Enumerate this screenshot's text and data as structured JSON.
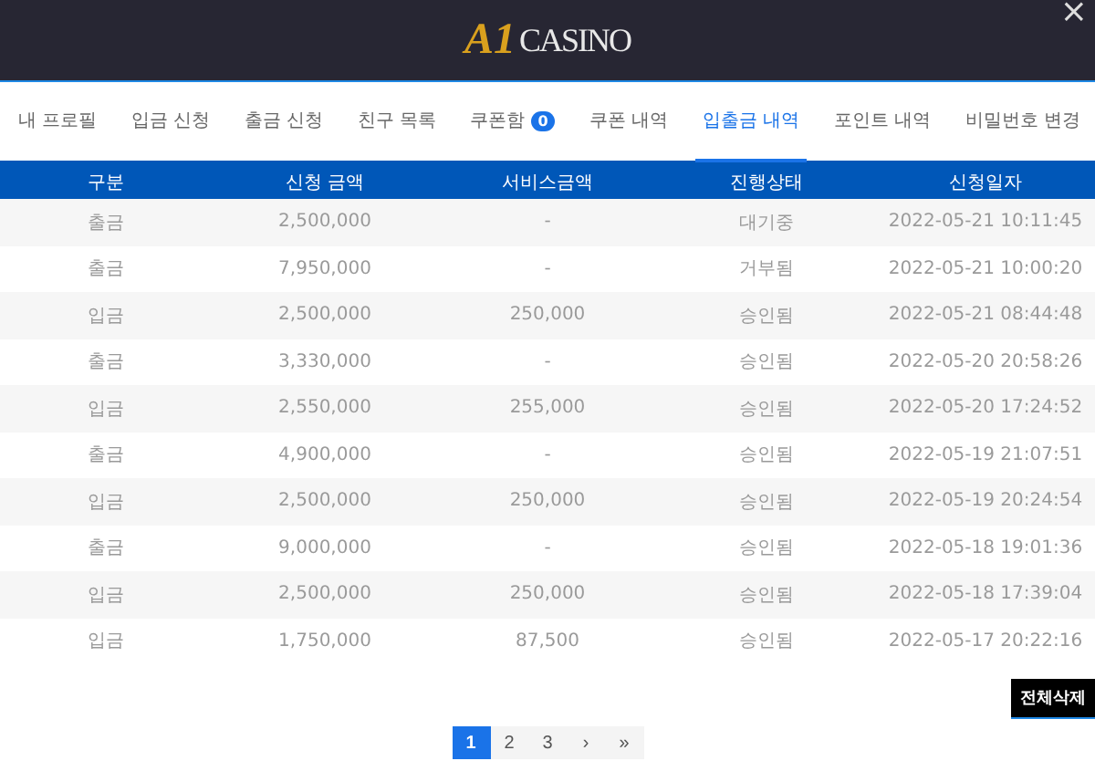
{
  "header": {
    "logo": {
      "mark": "A1",
      "text": "CASINO"
    },
    "close": "×"
  },
  "tabs": [
    {
      "label": "내 프로필",
      "selected": false
    },
    {
      "label": "입금 신청",
      "selected": false
    },
    {
      "label": "출금 신청",
      "selected": false
    },
    {
      "label": "친구 목록",
      "selected": false
    },
    {
      "label": "쿠폰함",
      "badge": "0",
      "selected": false
    },
    {
      "label": "쿠폰 내역",
      "selected": false
    },
    {
      "label": "입출금 내역",
      "selected": true
    },
    {
      "label": "포인트 내역",
      "selected": false
    },
    {
      "label": "비밀번호 변경",
      "selected": false
    }
  ],
  "table": {
    "columns": [
      "구분",
      "신청 금액",
      "서비스금액",
      "진행상태",
      "신청일자"
    ],
    "rows": [
      [
        "출금",
        "2,500,000",
        "-",
        "대기중",
        "2022-05-21 10:11:45"
      ],
      [
        "출금",
        "7,950,000",
        "-",
        "거부됨",
        "2022-05-21 10:00:20"
      ],
      [
        "입금",
        "2,500,000",
        "250,000",
        "승인됨",
        "2022-05-21 08:44:48"
      ],
      [
        "출금",
        "3,330,000",
        "-",
        "승인됨",
        "2022-05-20 20:58:26"
      ],
      [
        "입금",
        "2,550,000",
        "255,000",
        "승인됨",
        "2022-05-20 17:24:52"
      ],
      [
        "출금",
        "4,900,000",
        "-",
        "승인됨",
        "2022-05-19 21:07:51"
      ],
      [
        "입금",
        "2,500,000",
        "250,000",
        "승인됨",
        "2022-05-19 20:24:54"
      ],
      [
        "출금",
        "9,000,000",
        "-",
        "승인됨",
        "2022-05-18 19:01:36"
      ],
      [
        "입금",
        "2,500,000",
        "250,000",
        "승인됨",
        "2022-05-18 17:39:04"
      ],
      [
        "입금",
        "1,750,000",
        "87,500",
        "승인됨",
        "2022-05-17 20:22:16"
      ]
    ]
  },
  "delete_all_button": "전체삭제",
  "pagination": [
    {
      "label": "1",
      "selected": true
    },
    {
      "label": "2",
      "selected": false
    },
    {
      "label": "3",
      "selected": false
    },
    {
      "label": "›",
      "selected": false
    },
    {
      "label": "»",
      "selected": false
    }
  ]
}
